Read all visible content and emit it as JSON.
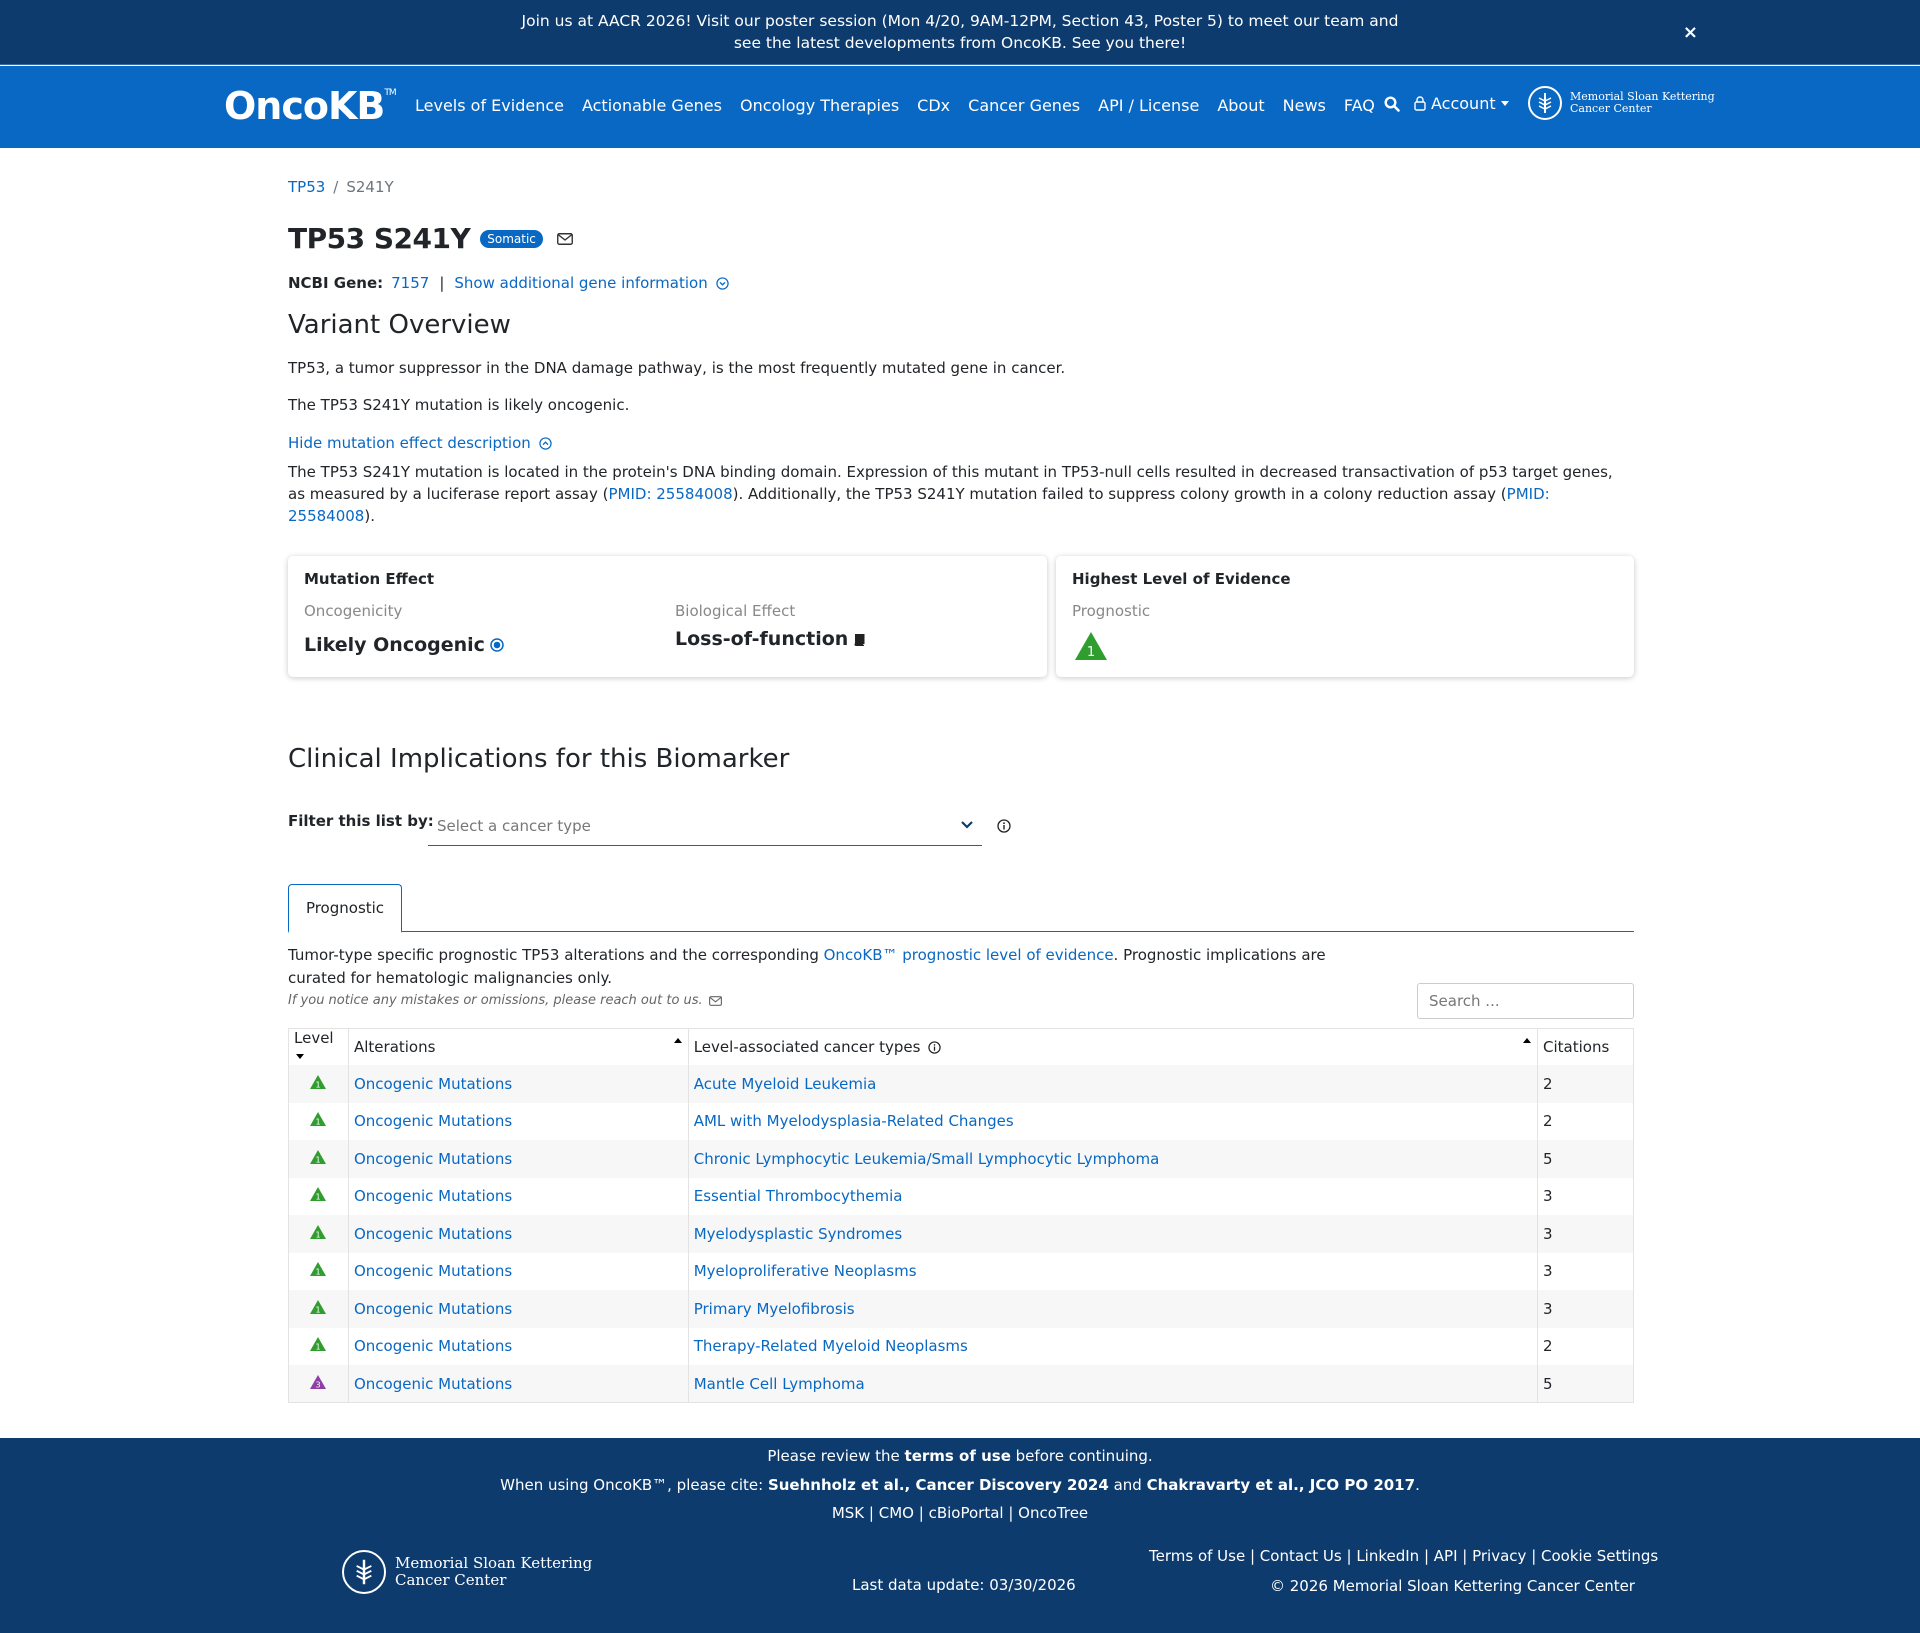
{
  "announcement": {
    "text": "Join us at AACR 2026! Visit our poster session (Mon 4/20, 9AM-12PM, Section 43, Poster 5) to meet our team and see the latest developments from OncoKB. See you there!",
    "close": "×"
  },
  "nav": {
    "brand": "OncoKB",
    "brand_tm": "TM",
    "links": [
      "Levels of Evidence",
      "Actionable Genes",
      "Oncology Therapies",
      "CDx",
      "Cancer Genes",
      "API / License",
      "About",
      "News",
      "FAQ"
    ],
    "account": "Account",
    "msk_line1": "Memorial Sloan Kettering",
    "msk_line2": "Cancer Center"
  },
  "breadcrumb": {
    "gene": "TP53",
    "variant": "S241Y"
  },
  "title": "TP53 S241Y",
  "badge": "Somatic",
  "ncbi": {
    "label": "NCBI Gene:",
    "id": "7157",
    "toggle": "Show additional gene information"
  },
  "overview": {
    "heading": "Variant Overview",
    "p1": "TP53, a tumor suppressor in the DNA damage pathway, is the most frequently mutated gene in cancer.",
    "p2": "The TP53 S241Y mutation is likely oncogenic.",
    "toggle": "Hide mutation effect description",
    "desc_a": "The TP53 S241Y mutation is located in the protein's DNA binding domain. Expression of this mutant in TP53-null cells resulted in decreased transactivation of p53 target genes, as measured by a luciferase report assay (",
    "desc_link1": "PMID: 25584008",
    "desc_b": "). Additionally, the TP53 S241Y mutation failed to suppress colony growth in a colony reduction assay (",
    "desc_link2": "PMID: 25584008",
    "desc_c": ")."
  },
  "mutation_card": {
    "heading": "Mutation Effect",
    "onc_label": "Oncogenicity",
    "onc_value": "Likely Oncogenic",
    "bio_label": "Biological Effect",
    "bio_value": "Loss-of-function"
  },
  "level_card": {
    "heading": "Highest Level of Evidence",
    "label": "Prognostic",
    "level": "1",
    "color": "#2f9e2f"
  },
  "clinical": {
    "heading": "Clinical Implications for this Biomarker",
    "filter_label": "Filter this list by:",
    "filter_placeholder": "Select a cancer type",
    "tab": "Prognostic",
    "desc_a": "Tumor-type specific prognostic TP53 alterations and the corresponding ",
    "desc_link": "OncoKB™ prognostic level of evidence",
    "desc_b": ". Prognostic implications are curated for hematologic malignancies only.",
    "note": "If you notice any mistakes or omissions, please reach out to us.",
    "search_placeholder": "Search ..."
  },
  "table": {
    "headers": {
      "level": "Level",
      "alterations": "Alterations",
      "cancer_types": "Level-associated cancer types",
      "citations": "Citations"
    },
    "rows": [
      {
        "level": "1",
        "color": "#2f9e2f",
        "alteration": "Oncogenic Mutations",
        "cancer_type": "Acute Myeloid Leukemia",
        "citations": "2"
      },
      {
        "level": "1",
        "color": "#2f9e2f",
        "alteration": "Oncogenic Mutations",
        "cancer_type": "AML with Myelodysplasia-Related Changes",
        "citations": "2"
      },
      {
        "level": "1",
        "color": "#2f9e2f",
        "alteration": "Oncogenic Mutations",
        "cancer_type": "Chronic Lymphocytic Leukemia/Small Lymphocytic Lymphoma",
        "citations": "5"
      },
      {
        "level": "1",
        "color": "#2f9e2f",
        "alteration": "Oncogenic Mutations",
        "cancer_type": "Essential Thrombocythemia",
        "citations": "3"
      },
      {
        "level": "1",
        "color": "#2f9e2f",
        "alteration": "Oncogenic Mutations",
        "cancer_type": "Myelodysplastic Syndromes",
        "citations": "3"
      },
      {
        "level": "1",
        "color": "#2f9e2f",
        "alteration": "Oncogenic Mutations",
        "cancer_type": "Myeloproliferative Neoplasms",
        "citations": "3"
      },
      {
        "level": "1",
        "color": "#2f9e2f",
        "alteration": "Oncogenic Mutations",
        "cancer_type": "Primary Myelofibrosis",
        "citations": "3"
      },
      {
        "level": "1",
        "color": "#2f9e2f",
        "alteration": "Oncogenic Mutations",
        "cancer_type": "Therapy-Related Myeloid Neoplasms",
        "citations": "2"
      },
      {
        "level": "3",
        "color": "#8e3fa7",
        "alteration": "Oncogenic Mutations",
        "cancer_type": "Mantle Cell Lymphoma",
        "citations": "5"
      }
    ]
  },
  "footer": {
    "review_a": "Please review the ",
    "review_b": "terms of use",
    "review_c": " before continuing.",
    "cite_a": "When using OncoKB™, please cite: ",
    "cite_b": "Suehnholz et al., Cancer Discovery 2024",
    "cite_c": " and ",
    "cite_d": "Chakravarty et al., JCO PO 2017",
    "cite_e": ".",
    "partners": [
      "MSK",
      "CMO",
      "cBioPortal",
      "OncoTree"
    ],
    "links": [
      "Terms of Use",
      "Contact Us",
      "LinkedIn",
      "API",
      "Privacy",
      "Cookie Settings"
    ],
    "update": "Last data update: 03/30/2026",
    "copyright": "© 2026 Memorial Sloan Kettering Cancer Center"
  }
}
